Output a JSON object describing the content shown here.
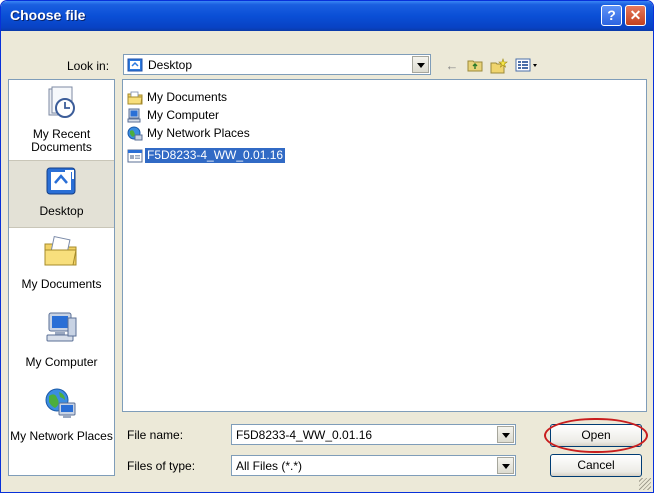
{
  "window": {
    "title": "Choose file"
  },
  "look_in": {
    "label": "Look in:",
    "value": "Desktop"
  },
  "places": [
    {
      "label": "My Recent Documents",
      "icon": "recent-documents-icon"
    },
    {
      "label": "Desktop",
      "icon": "desktop-icon",
      "selected": true
    },
    {
      "label": "My Documents",
      "icon": "my-documents-icon"
    },
    {
      "label": "My Computer",
      "icon": "my-computer-icon"
    },
    {
      "label": "My Network Places",
      "icon": "network-places-icon"
    }
  ],
  "files": [
    {
      "name": "My Documents",
      "icon": "folder-icon"
    },
    {
      "name": "My Computer",
      "icon": "computer-icon"
    },
    {
      "name": "My Network Places",
      "icon": "network-icon"
    },
    {
      "name": "F5D8233-4_WW_0.01.16",
      "icon": "file-icon",
      "selected": true
    }
  ],
  "file_name": {
    "label": "File name:",
    "value": "F5D8233-4_WW_0.01.16"
  },
  "file_type": {
    "label": "Files of type:",
    "value": "All Files (*.*)"
  },
  "buttons": {
    "open": "Open",
    "cancel": "Cancel"
  },
  "colors": {
    "titlebar": "#0a4fd6",
    "selection": "#316ac5",
    "highlight_ring": "#c81e1e"
  }
}
